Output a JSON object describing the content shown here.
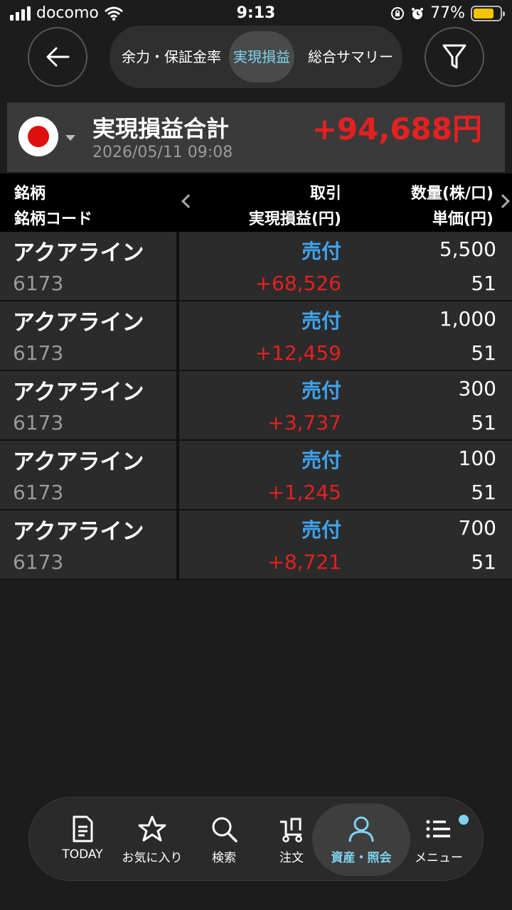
{
  "status_bar": {
    "carrier": "docomo",
    "time": "9:13",
    "battery": "77%",
    "battery_level": 0.77
  },
  "header": {
    "tabs": [
      {
        "label": "余力・保証金率",
        "active": false
      },
      {
        "label": "実現損益",
        "active": true
      },
      {
        "label": "総合サマリー",
        "active": false
      }
    ]
  },
  "summary": {
    "title": "実現損益合計",
    "date": "2026/05/11 09:08",
    "total": "+94,688円"
  },
  "table": {
    "columns": {
      "name": "銘柄",
      "code": "銘柄コード",
      "trade": "取引",
      "pnl": "実現損益(円)",
      "qty": "数量(株/口)",
      "price": "単価(円)"
    },
    "rows": [
      {
        "name": "アクアライン",
        "code": "6173",
        "trade": "売付",
        "pnl": "+68,526",
        "qty": "5,500",
        "price": "51"
      },
      {
        "name": "アクアライン",
        "code": "6173",
        "trade": "売付",
        "pnl": "+12,459",
        "qty": "1,000",
        "price": "51"
      },
      {
        "name": "アクアライン",
        "code": "6173",
        "trade": "売付",
        "pnl": "+3,737",
        "qty": "300",
        "price": "51"
      },
      {
        "name": "アクアライン",
        "code": "6173",
        "trade": "売付",
        "pnl": "+1,245",
        "qty": "100",
        "price": "51"
      },
      {
        "name": "アクアライン",
        "code": "6173",
        "trade": "売付",
        "pnl": "+8,721",
        "qty": "700",
        "price": "51"
      }
    ]
  },
  "nav": {
    "items": [
      {
        "label": "TODAY",
        "icon": "document-icon",
        "active": false
      },
      {
        "label": "お気に入り",
        "icon": "star-icon",
        "active": false
      },
      {
        "label": "検索",
        "icon": "search-icon",
        "active": false
      },
      {
        "label": "注文",
        "icon": "cart-icon",
        "active": false
      },
      {
        "label": "資産・照会",
        "icon": "person-icon",
        "active": true
      },
      {
        "label": "メニュー",
        "icon": "menu-icon",
        "active": false
      }
    ]
  },
  "colors": {
    "accent": "#7fd3f0",
    "profit": "#e62020",
    "trade": "#3fa4f0",
    "background": "#1c1c1c"
  }
}
